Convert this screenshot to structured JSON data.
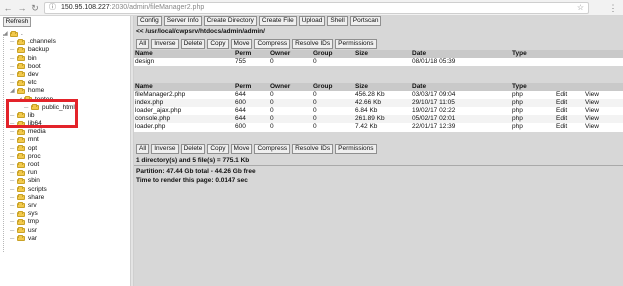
{
  "browser": {
    "url_host": "150.95.108.227",
    "url_path": ":2030/admin/fileManager2.php"
  },
  "tree": {
    "refresh_label": "Refresh",
    "items": [
      {
        "label": ".",
        "depth": 0
      },
      {
        "label": ".channels",
        "depth": 1
      },
      {
        "label": "backup",
        "depth": 1
      },
      {
        "label": "bin",
        "depth": 1
      },
      {
        "label": "boot",
        "depth": 1
      },
      {
        "label": "dev",
        "depth": 1
      },
      {
        "label": "etc",
        "depth": 1
      },
      {
        "label": "home",
        "depth": 1
      },
      {
        "label": "tenten",
        "depth": 2
      },
      {
        "label": "public_html",
        "depth": 3
      },
      {
        "label": "lib",
        "depth": 1
      },
      {
        "label": "lib64",
        "depth": 1
      },
      {
        "label": "media",
        "depth": 1
      },
      {
        "label": "mnt",
        "depth": 1
      },
      {
        "label": "opt",
        "depth": 1
      },
      {
        "label": "proc",
        "depth": 1
      },
      {
        "label": "root",
        "depth": 1
      },
      {
        "label": "run",
        "depth": 1
      },
      {
        "label": "sbin",
        "depth": 1
      },
      {
        "label": "scripts",
        "depth": 1
      },
      {
        "label": "share",
        "depth": 1
      },
      {
        "label": "srv",
        "depth": 1
      },
      {
        "label": "sys",
        "depth": 1
      },
      {
        "label": "tmp",
        "depth": 1
      },
      {
        "label": "usr",
        "depth": 1
      },
      {
        "label": "var",
        "depth": 1
      }
    ]
  },
  "toolbar": {
    "buttons": [
      "Config",
      "Server Info",
      "Create Directory",
      "Create File",
      "Upload",
      "Shell",
      "Portscan"
    ]
  },
  "path": "<< /usr/local/cwpsrv/htdocs/admin/admin/",
  "selection_toolbar": {
    "buttons": [
      "All",
      "Inverse",
      "Delete",
      "Copy",
      "Move",
      "Compress",
      "Resolve IDs",
      "Permissions"
    ]
  },
  "columns": {
    "name": "Name",
    "perm": "Perm",
    "owner": "Owner",
    "group": "Group",
    "size": "Size",
    "date": "Date",
    "type": "Type"
  },
  "directories": [
    {
      "name": "design",
      "perm": "755",
      "owner": "0",
      "group": "0",
      "size": "",
      "date": "08/01/18 05:39",
      "type": ""
    }
  ],
  "files": [
    {
      "name": "fileManager2.php",
      "perm": "644",
      "owner": "0",
      "group": "0",
      "size": "456.28 Kb",
      "date": "03/03/17 09:04",
      "type": "php",
      "edit": "Edit",
      "view": "View"
    },
    {
      "name": "index.php",
      "perm": "600",
      "owner": "0",
      "group": "0",
      "size": "42.66 Kb",
      "date": "29/10/17 11:05",
      "type": "php",
      "edit": "Edit",
      "view": "View"
    },
    {
      "name": "loader_ajax.php",
      "perm": "644",
      "owner": "0",
      "group": "0",
      "size": "6.84 Kb",
      "date": "19/02/17 02:22",
      "type": "php",
      "edit": "Edit",
      "view": "View"
    },
    {
      "name": "console.php",
      "perm": "644",
      "owner": "0",
      "group": "0",
      "size": "261.89 Kb",
      "date": "05/02/17 02:01",
      "type": "php",
      "edit": "Edit",
      "view": "View"
    },
    {
      "name": "loader.php",
      "perm": "600",
      "owner": "0",
      "group": "0",
      "size": "7.42 Kb",
      "date": "22/01/17 12:39",
      "type": "php",
      "edit": "Edit",
      "view": "View"
    }
  ],
  "summary": {
    "count": "1 directory(s) and 5 file(s) = 775.1 Kb",
    "partition": "Partition: 47.44 Gb total - 44.26 Gb free",
    "render_time": "Time to render this page: 0.0147 sec"
  },
  "colors": {
    "highlight": "#e3232a",
    "folder": "#f2c94c",
    "panel_bg": "#d7d7d7"
  }
}
